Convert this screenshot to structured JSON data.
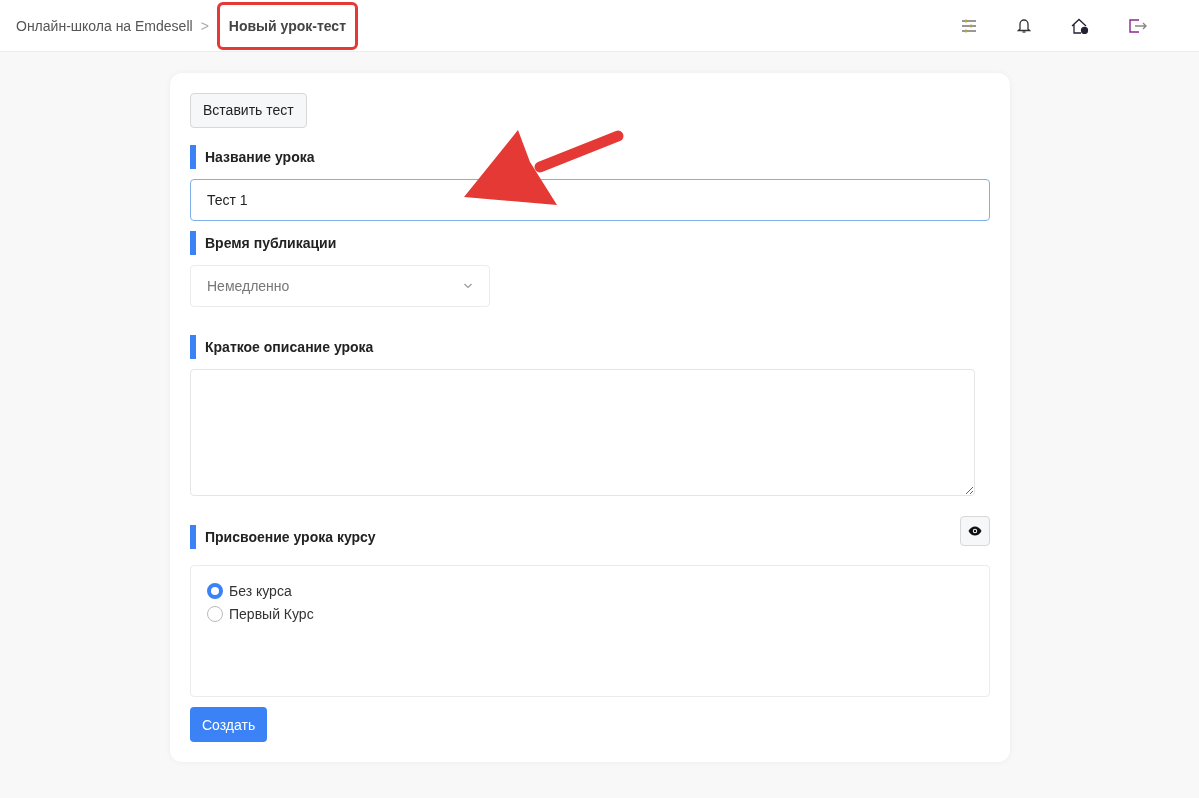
{
  "breadcrumb": {
    "items": [
      {
        "label": "Онлайн-школа на Emdesell",
        "current": false
      },
      {
        "label": "Новый урок-тест",
        "current": true
      }
    ],
    "separator": ">"
  },
  "insert_button": "Вставить тест",
  "fields": [
    {
      "kind": "text",
      "label": "Название урока",
      "value": "Тест 1",
      "focused": true
    },
    {
      "kind": "select",
      "label": "Время публикации",
      "value": "Немедленно"
    },
    {
      "kind": "textarea",
      "label": "Краткое описание урока"
    }
  ],
  "course_section": {
    "label": "Присвоение урока курсу",
    "options": [
      {
        "label": "Без курса",
        "selected": true
      },
      {
        "label": "Первый Курс",
        "selected": false
      }
    ]
  },
  "submit_button": "Создать"
}
